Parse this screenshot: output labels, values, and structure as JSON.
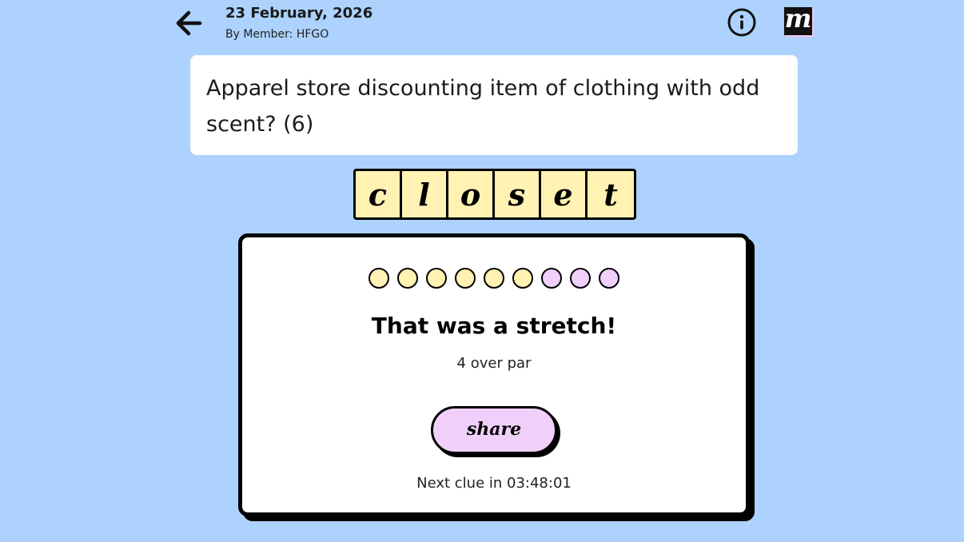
{
  "header": {
    "date": "23 February, 2026",
    "author": "By Member: HFGO",
    "logo_glyph": "m"
  },
  "clue": {
    "text": "Apparel store discounting item of clothing with odd scent? (6)"
  },
  "answer": {
    "letters": [
      "c",
      "l",
      "o",
      "s",
      "e",
      "t"
    ]
  },
  "result": {
    "dots": [
      {
        "state": "used",
        "color": "#fff2b3"
      },
      {
        "state": "used",
        "color": "#fff2b3"
      },
      {
        "state": "used",
        "color": "#fff2b3"
      },
      {
        "state": "used",
        "color": "#fff2b3"
      },
      {
        "state": "used",
        "color": "#fff2b3"
      },
      {
        "state": "used",
        "color": "#fff2b3"
      },
      {
        "state": "remaining",
        "color": "#f0d0fa"
      },
      {
        "state": "remaining",
        "color": "#f0d0fa"
      },
      {
        "state": "remaining",
        "color": "#f0d0fa"
      }
    ],
    "title": "That was a stretch!",
    "subtitle": "4 over par",
    "share_label": "share",
    "next_clue": "Next clue in 03:48:01"
  },
  "colors": {
    "background": "#acd2fd",
    "tile": "#fff2b3",
    "accent_pink": "#f0d0fa"
  },
  "icons": {
    "back": "arrow-left-icon",
    "info": "info-icon",
    "logo": "brand-logo"
  }
}
